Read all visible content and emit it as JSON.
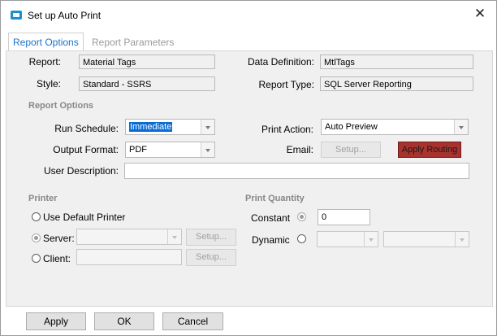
{
  "window": {
    "title": "Set up Auto Print",
    "close_glyph": "✕"
  },
  "tabs": [
    {
      "label": "Report Options"
    },
    {
      "label": "Report Parameters"
    }
  ],
  "report": {
    "report_label": "Report:",
    "report_value": "Material Tags",
    "style_label": "Style:",
    "style_value": "Standard - SSRS",
    "data_definition_label": "Data Definition:",
    "data_definition_value": "MtlTags",
    "report_type_label": "Report Type:",
    "report_type_value": "SQL Server Reporting"
  },
  "options": {
    "section_label": "Report Options",
    "run_schedule_label": "Run Schedule:",
    "run_schedule_value": "Immediate",
    "output_format_label": "Output Format:",
    "output_format_value": "PDF",
    "print_action_label": "Print Action:",
    "print_action_value": "Auto Preview",
    "email_label": "Email:",
    "email_setup_label": "Setup...",
    "apply_routing_label": "Apply Routing",
    "user_description_label": "User Description:",
    "user_description_value": ""
  },
  "printer": {
    "section_label": "Printer",
    "use_default_label": "Use Default Printer",
    "server_label": "Server:",
    "server_setup_label": "Setup...",
    "client_label": "Client:",
    "client_setup_label": "Setup..."
  },
  "quantity": {
    "section_label": "Print Quantity",
    "constant_label": "Constant",
    "constant_value": "0",
    "dynamic_label": "Dynamic"
  },
  "footer": {
    "apply_label": "Apply",
    "ok_label": "OK",
    "cancel_label": "Cancel"
  },
  "colors": {
    "accent": "#1a73c9",
    "routing": "#a8322d",
    "selection": "#0a6bd6"
  }
}
